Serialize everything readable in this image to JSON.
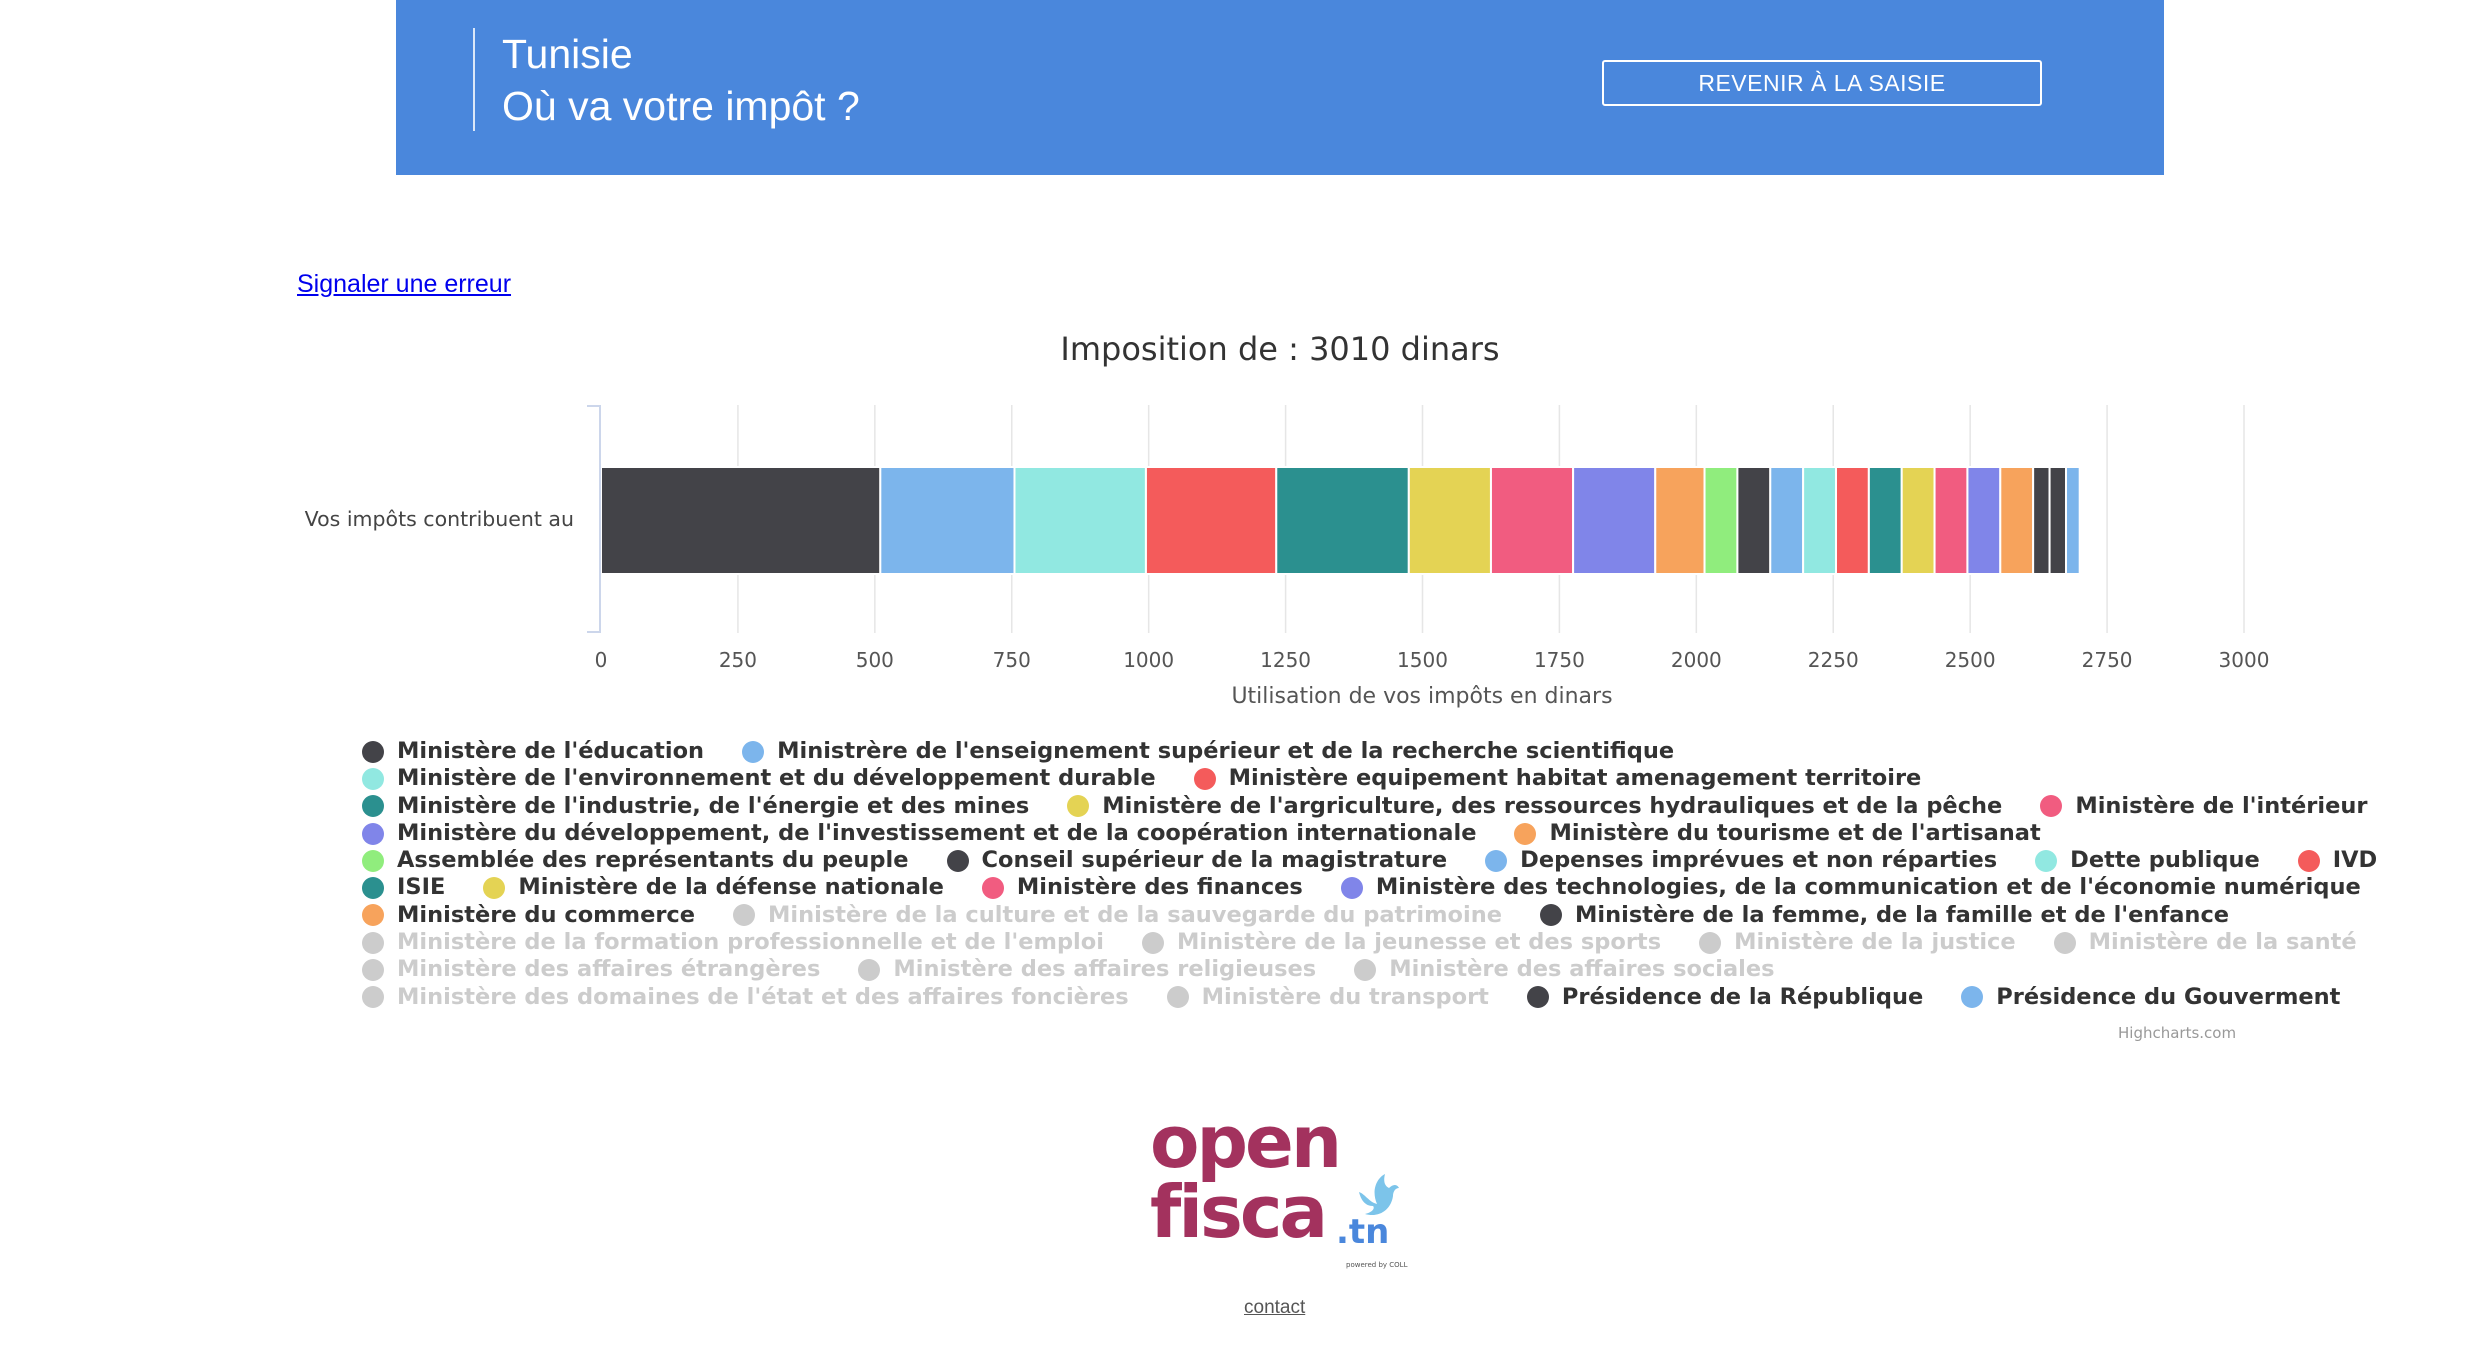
{
  "header": {
    "title_line1": "Tunisie",
    "title_line2": "Où va votre impôt ?",
    "back_button": "REVENIR À LA SAISIE",
    "color": "#4a87dc"
  },
  "report_link": "Signaler une erreur",
  "credits": "Highcharts.com",
  "logo": {
    "open": "open",
    "fisca": "fisca",
    "tn": ".tn",
    "powered": "powered by COLL"
  },
  "contact": "contact",
  "chart_data": {
    "type": "bar",
    "stacked": true,
    "orientation": "horizontal",
    "title": "Imposition de : 3010 dinars",
    "categories": [
      "Vos impôts contribuent au"
    ],
    "xlabel": "",
    "ylabel": "Utilisation de vos impôts en dinars",
    "xlim": [
      0,
      3000
    ],
    "ticks": [
      "0",
      "250",
      "500",
      "750",
      "1000",
      "1250",
      "1500",
      "1750",
      "2000",
      "2250",
      "2500",
      "2750",
      "3000"
    ],
    "grid": true,
    "legend_position": "bottom",
    "series": [
      {
        "name": "Ministère de l'éducation",
        "color": "#434348",
        "value": 510,
        "visible": true
      },
      {
        "name": "Ministrère de l'enseignement supérieur et de la recherche scientifique",
        "color": "#7cb5ec",
        "value": 245,
        "visible": true
      },
      {
        "name": "Ministère de l'environnement et du développement durable",
        "color": "#91e8e1",
        "value": 240,
        "visible": true
      },
      {
        "name": "Ministère equipement habitat amenagement territoire",
        "color": "#f45b5b",
        "value": 238,
        "visible": true
      },
      {
        "name": "Ministère de l'industrie, de l'énergie et des mines",
        "color": "#2b908f",
        "value": 242,
        "visible": true
      },
      {
        "name": "Ministère de l'argriculture, des ressources hydrauliques et de la pêche",
        "color": "#e4d354",
        "value": 150,
        "visible": true
      },
      {
        "name": "Ministère de l'intérieur",
        "color": "#f15c80",
        "value": 150,
        "visible": true
      },
      {
        "name": "Ministère du développement, de l'investissement et de la coopération internationale",
        "color": "#8085e9",
        "value": 150,
        "visible": true
      },
      {
        "name": "Ministère du tourisme et de l'artisanat",
        "color": "#f7a35c",
        "value": 90,
        "visible": true
      },
      {
        "name": "Assemblée des représentants du peuple",
        "color": "#90ed7d",
        "value": 60,
        "visible": true
      },
      {
        "name": "Conseil supérieur de la magistrature",
        "color": "#434348",
        "value": 60,
        "visible": true
      },
      {
        "name": "Depenses imprévues et non réparties",
        "color": "#7cb5ec",
        "value": 60,
        "visible": true
      },
      {
        "name": "Dette publique",
        "color": "#91e8e1",
        "value": 60,
        "visible": true
      },
      {
        "name": "IVD",
        "color": "#f45b5b",
        "value": 60,
        "visible": true
      },
      {
        "name": "ISIE",
        "color": "#2b908f",
        "value": 60,
        "visible": true
      },
      {
        "name": "Ministère de la défense nationale",
        "color": "#e4d354",
        "value": 60,
        "visible": true
      },
      {
        "name": "Ministère des finances",
        "color": "#f15c80",
        "value": 60,
        "visible": true
      },
      {
        "name": "Ministère des technologies, de la communication et de l'économie numérique",
        "color": "#8085e9",
        "value": 60,
        "visible": true
      },
      {
        "name": "Ministère du commerce",
        "color": "#f7a35c",
        "value": 60,
        "visible": true
      },
      {
        "name": "Ministère de la culture et de la sauvegarde du patrimoine",
        "color": "#cccccc",
        "value": 0,
        "visible": false
      },
      {
        "name": "Ministère de la femme, de la famille et de l'enfance",
        "color": "#434348",
        "value": 30,
        "visible": true
      },
      {
        "name": "Ministère de la formation professionnelle et de l'emploi",
        "color": "#cccccc",
        "value": 0,
        "visible": false
      },
      {
        "name": "Ministère de la jeunesse et des sports",
        "color": "#cccccc",
        "value": 0,
        "visible": false
      },
      {
        "name": "Ministère de la justice",
        "color": "#cccccc",
        "value": 0,
        "visible": false
      },
      {
        "name": "Ministère de la santé",
        "color": "#cccccc",
        "value": 0,
        "visible": false
      },
      {
        "name": "Ministère des affaires étrangères",
        "color": "#cccccc",
        "value": 0,
        "visible": false
      },
      {
        "name": "Ministère des affaires religieuses",
        "color": "#cccccc",
        "value": 0,
        "visible": false
      },
      {
        "name": "Ministère des affaires sociales",
        "color": "#cccccc",
        "value": 0,
        "visible": false
      },
      {
        "name": "Ministère des domaines de l'état et des affaires foncières",
        "color": "#cccccc",
        "value": 0,
        "visible": false
      },
      {
        "name": "Ministère du transport",
        "color": "#cccccc",
        "value": 0,
        "visible": false
      },
      {
        "name": "Présidence de la République",
        "color": "#434348",
        "value": 30,
        "visible": true
      },
      {
        "name": "Présidence du Gouverment",
        "color": "#7cb5ec",
        "value": 25,
        "visible": true
      }
    ],
    "legend_rows": [
      [
        0,
        1
      ],
      [
        2,
        3
      ],
      [
        4,
        5,
        6
      ],
      [
        7,
        8
      ],
      [
        9,
        10,
        11,
        12,
        13
      ],
      [
        14,
        15,
        16,
        17
      ],
      [
        18,
        19,
        20
      ],
      [
        21,
        22,
        23,
        24
      ],
      [
        25,
        26,
        27
      ],
      [
        28,
        29,
        30,
        31
      ]
    ]
  }
}
